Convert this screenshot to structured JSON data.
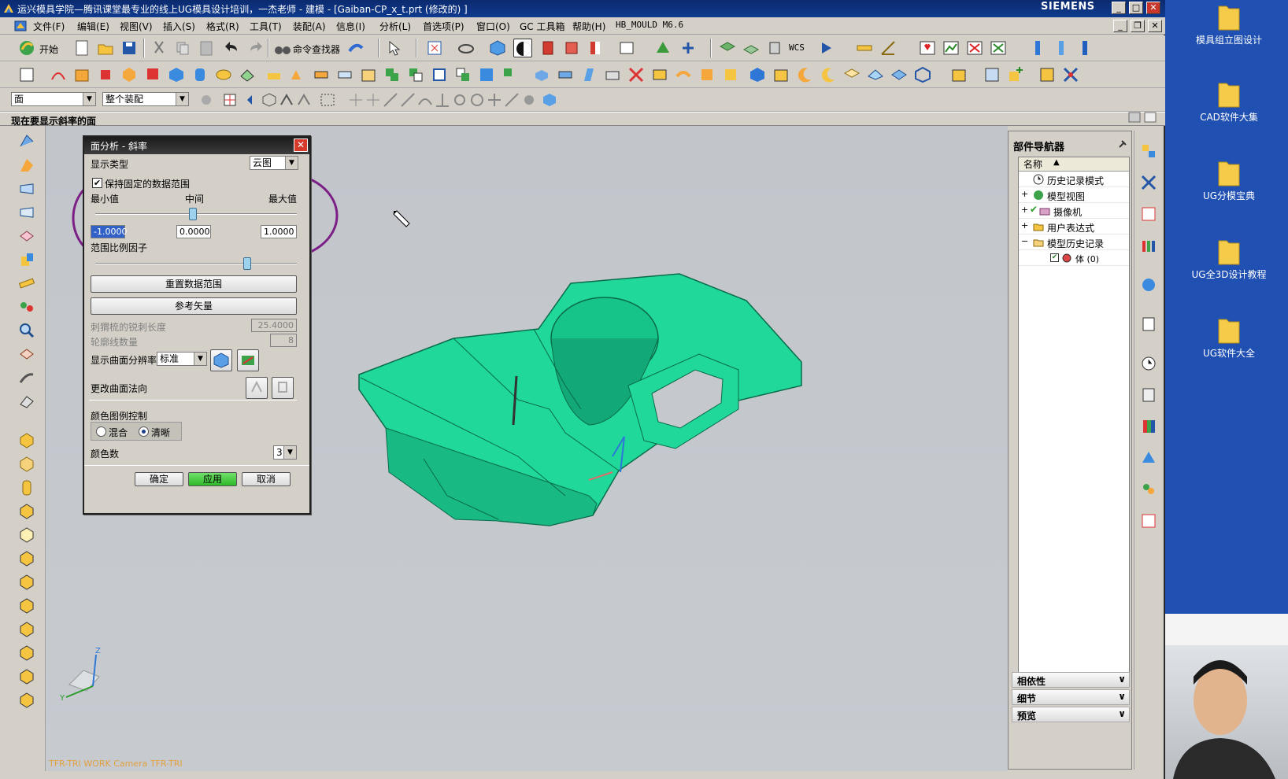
{
  "window": {
    "title": "运兴模具学院—腾讯课堂最专业的线上UG模具设计培训，一杰老师 - 建模 - [Gaiban-CP_x_t.prt  (修改的) ]",
    "brand": "SIEMENS",
    "min": "_",
    "max": "□",
    "close": "✕"
  },
  "menu": [
    "文件(F)",
    "编辑(E)",
    "视图(V)",
    "插入(S)",
    "格式(R)",
    "工具(T)",
    "装配(A)",
    "信息(I)",
    "分析(L)",
    "首选项(P)",
    "窗口(O)",
    "GC 工具箱",
    "帮助(H)",
    "HB_MOULD M6.6"
  ],
  "toolbar1": {
    "start_label": "开始",
    "command_finder": "命令查找器",
    "wcs_label": "WCS"
  },
  "toolbar3": {
    "filter_value": "面",
    "scope_value": "整个装配"
  },
  "cue_line": "现在要显示斜率的面",
  "dialog": {
    "title": "面分析 - 斜率",
    "display_type_label": "显示类型",
    "display_type_value": "云图",
    "keep_fixed_range": "保持固定的数据范围",
    "keep_fixed_checked": true,
    "min_label": "最小值",
    "mid_label": "中间",
    "max_label": "最大值",
    "min_value": "-1.0000",
    "mid_value": "0.0000",
    "max_value": "1.0000",
    "range_factor_label": "范围比例因子",
    "reset_range_button": "重置数据范围",
    "ref_vector_button": "参考矢量",
    "hedgehog_label": "刺猬梳的锐刺长度",
    "hedgehog_value": "25.4000",
    "contour_count_label": "轮廓线数量",
    "contour_count_value": "8",
    "resolution_label": "显示曲面分辨率",
    "resolution_value": "标准",
    "change_normal_label": "更改曲面法向",
    "legend_control_label": "颜色图例控制",
    "blend_option": "混合",
    "sharp_option": "清晰",
    "sharp_selected": true,
    "color_count_label": "颜色数",
    "color_count_value": "3",
    "ok_button": "确定",
    "apply_button": "应用",
    "cancel_button": "取消"
  },
  "viewport": {
    "status_text": "TFR-TRI WORK Camera TFR-TRI",
    "triad_x": "X",
    "triad_y": "Y",
    "triad_z": "Z",
    "model_color": "#1fd89a"
  },
  "navigator": {
    "title": "部件导航器",
    "column_name": "名称",
    "items": [
      {
        "label": "历史记录模式",
        "expand": ""
      },
      {
        "label": "模型视图",
        "expand": "+"
      },
      {
        "label": "摄像机",
        "expand": "+"
      },
      {
        "label": "用户表达式",
        "expand": "+"
      },
      {
        "label": "模型历史记录",
        "expand": "−"
      },
      {
        "label": "体 (0)",
        "expand": ""
      }
    ],
    "sections": [
      "相依性",
      "细节",
      "预览"
    ]
  },
  "desktop": {
    "icons": [
      "模具组立图设计",
      "CAD软件大集",
      "UG分模宝典",
      "UG全3D设计教程",
      "UG软件大全"
    ]
  },
  "annotation_color": "#7b1f86"
}
